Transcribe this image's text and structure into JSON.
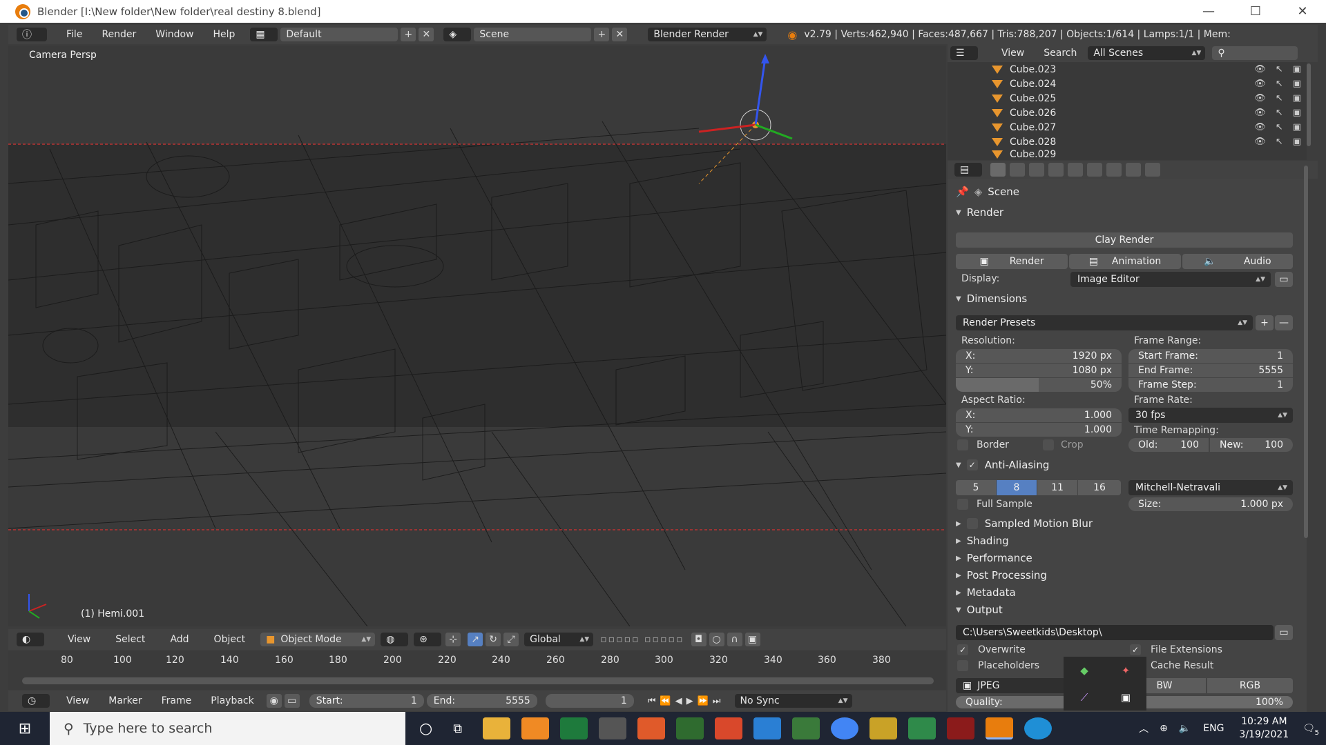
{
  "window": {
    "title": "Blender [I:\\New folder\\New folder\\real destiny 8.blend]"
  },
  "infobar": {
    "menus": [
      "File",
      "Render",
      "Window",
      "Help"
    ],
    "layout": "Default",
    "scene": "Scene",
    "engine": "Blender Render",
    "stats": "v2.79 | Verts:462,940 | Faces:487,667 | Tris:788,207 | Objects:1/614 | Lamps:1/1 | Mem:"
  },
  "viewport": {
    "view_label": "Camera Persp",
    "object_label": "(1) Hemi.001",
    "header_menus": [
      "View",
      "Select",
      "Add",
      "Object"
    ],
    "mode": "Object Mode",
    "orientation": "Global"
  },
  "timeline": {
    "ruler": [
      "80",
      "100",
      "120",
      "140",
      "160",
      "180",
      "200",
      "220",
      "240",
      "260",
      "280",
      "300",
      "320",
      "340",
      "360",
      "380"
    ],
    "menus": [
      "View",
      "Marker",
      "Frame",
      "Playback"
    ],
    "start_label": "Start:",
    "start": "1",
    "end_label": "End:",
    "end": "5555",
    "current": "1",
    "sync": "No Sync"
  },
  "outliner": {
    "menus": [
      "View",
      "Search"
    ],
    "filter": "All Scenes",
    "items": [
      "Cube.023",
      "Cube.024",
      "Cube.025",
      "Cube.026",
      "Cube.027",
      "Cube.028",
      "Cube.029"
    ]
  },
  "properties": {
    "context": "Scene",
    "render_section": "Render",
    "clay_render": "Clay Render",
    "render_btn": "Render",
    "animation_btn": "Animation",
    "audio_btn": "Audio",
    "display_label": "Display:",
    "display_value": "Image Editor",
    "dimensions_section": "Dimensions",
    "render_presets": "Render Presets",
    "resolution_label": "Resolution:",
    "res_x_label": "X:",
    "res_x": "1920 px",
    "res_y_label": "Y:",
    "res_y": "1080 px",
    "res_pct": "50%",
    "frame_range_label": "Frame Range:",
    "start_frame_label": "Start Frame:",
    "start_frame": "1",
    "end_frame_label": "End Frame:",
    "end_frame": "5555",
    "frame_step_label": "Frame Step:",
    "frame_step": "1",
    "aspect_label": "Aspect Ratio:",
    "aspect_x_label": "X:",
    "aspect_x": "1.000",
    "aspect_y_label": "Y:",
    "aspect_y": "1.000",
    "frame_rate_label": "Frame Rate:",
    "frame_rate": "30 fps",
    "border_label": "Border",
    "crop_label": "Crop",
    "time_remap_label": "Time Remapping:",
    "old_label": "Old:",
    "old": "100",
    "new_label": "New:",
    "new": "100",
    "aa_section": "Anti-Aliasing",
    "aa_samples": [
      "5",
      "8",
      "11",
      "16"
    ],
    "aa_selected": "8",
    "aa_filter": "Mitchell-Netravali",
    "full_sample": "Full Sample",
    "size_label": "Size:",
    "size": "1.000 px",
    "collapsed_sections": [
      "Sampled Motion Blur",
      "Shading",
      "Performance",
      "Post Processing",
      "Metadata"
    ],
    "output_section": "Output",
    "output_path": "C:\\Users\\Sweetkids\\Desktop\\",
    "overwrite": "Overwrite",
    "file_extensions": "File Extensions",
    "placeholders": "Placeholders",
    "cache_result": "Cache Result",
    "format": "JPEG",
    "bw": "BW",
    "rgb": "RGB",
    "quality_label": "Quality:",
    "quality": "100%"
  },
  "taskbar": {
    "search_placeholder": "Type here to search",
    "lang": "ENG",
    "time": "10:29 AM",
    "date": "3/19/2021",
    "notif": "5"
  },
  "colors": {
    "accent_blue": "#5680c2",
    "blender_orange": "#e87d0d",
    "viewport_bg": "#3a3a3a"
  }
}
